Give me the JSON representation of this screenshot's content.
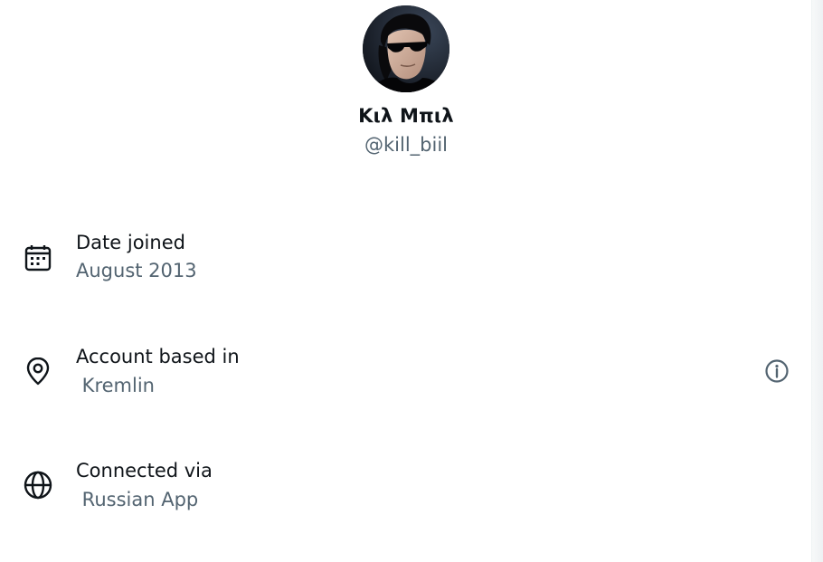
{
  "profile": {
    "display_name": "Κιλ Μπιλ",
    "handle": "@kill_biil"
  },
  "about": [
    {
      "icon": "calendar-icon",
      "label": "Date joined",
      "value": "August 2013"
    },
    {
      "icon": "location-pin-icon",
      "label": "Account based in",
      "value": " Kremlin"
    },
    {
      "icon": "globe-icon",
      "label": "Connected via",
      "value": " Russian App"
    }
  ],
  "icons": {
    "info": "info-circle-icon"
  },
  "colors": {
    "text_primary": "#0f1419",
    "text_secondary": "#536471"
  }
}
